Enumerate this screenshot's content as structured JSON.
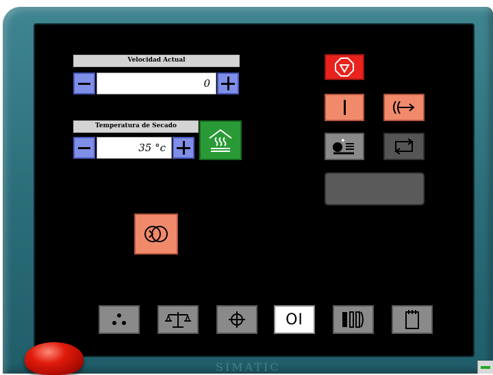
{
  "speed_panel": {
    "title": "Velocidad Actual",
    "value": "0"
  },
  "temperature_panel": {
    "title": "Temperatura de Secado",
    "value": "35  °c"
  },
  "bottom_tabs": {
    "selected_label": "OI"
  },
  "brand_text": "SIMATIC",
  "colors": {
    "screen": "#000000",
    "bezel": "#2a6d78",
    "control_salmon": "#f08a6b",
    "stop_red": "#e8231e",
    "heater_green": "#2a9a36",
    "stepper_blue": "#7f8fe8"
  }
}
